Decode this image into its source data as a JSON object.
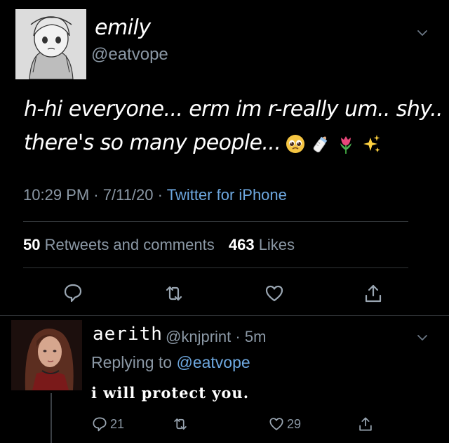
{
  "main_tweet": {
    "author_name": "emily",
    "author_handle": "@eatvope",
    "text_line1": "h-hi everyone... erm im r-really um.. shy..",
    "text_line2": "there's so many people...",
    "emojis": [
      "pleading-face",
      "baby-bottle",
      "tulip",
      "sparkles"
    ],
    "time": "10:29 PM",
    "date": "7/11/20",
    "separator": "·",
    "client": "Twitter for iPhone",
    "retweets_count": "50",
    "retweets_label": "Retweets and comments",
    "likes_count": "463",
    "likes_label": "Likes",
    "actions": [
      "reply-icon",
      "retweet-icon",
      "like-icon",
      "share-icon"
    ]
  },
  "reply_tweet": {
    "author_name": "aerith",
    "author_handle": "@knjprint",
    "separator": "·",
    "age": "5m",
    "replying_prefix": "Replying to",
    "replying_to": "@eatvope",
    "text": "i will protect you.",
    "reply_count": "21",
    "like_count": "29"
  },
  "colors": {
    "background": "#000000",
    "secondary_text": "#8b98a5",
    "link": "#6ea8e0",
    "divider": "#2f3336"
  }
}
